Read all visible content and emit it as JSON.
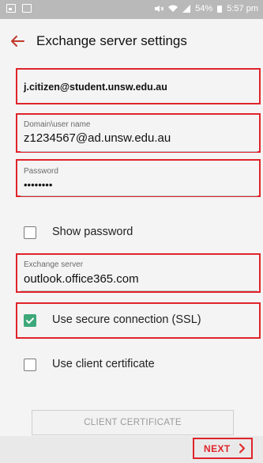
{
  "status_bar": {
    "battery": "54%",
    "time": "5:57 pm"
  },
  "app_bar": {
    "back_icon": "arrow-left-icon",
    "title": "Exchange server settings"
  },
  "account": {
    "email": "j.citizen@student.unsw.edu.au"
  },
  "domain_username": {
    "label": "Domain\\user name",
    "value": "z1234567@ad.unsw.edu.au"
  },
  "password": {
    "label": "Password",
    "value": "••••••••"
  },
  "show_password": {
    "label": "Show password",
    "checked": false
  },
  "exchange_server": {
    "label": "Exchange server",
    "value": "outlook.office365.com"
  },
  "ssl": {
    "label": "Use secure connection (SSL)",
    "checked": true
  },
  "client_certificate": {
    "label": "Use client certificate",
    "checked": false,
    "button_label": "CLIENT CERTIFICATE"
  },
  "footer": {
    "next_label": "NEXT"
  },
  "colors": {
    "highlight_red": "#e0242a",
    "checkbox_green": "#3fa87a",
    "status_bar_gray": "#b9b9b9"
  }
}
